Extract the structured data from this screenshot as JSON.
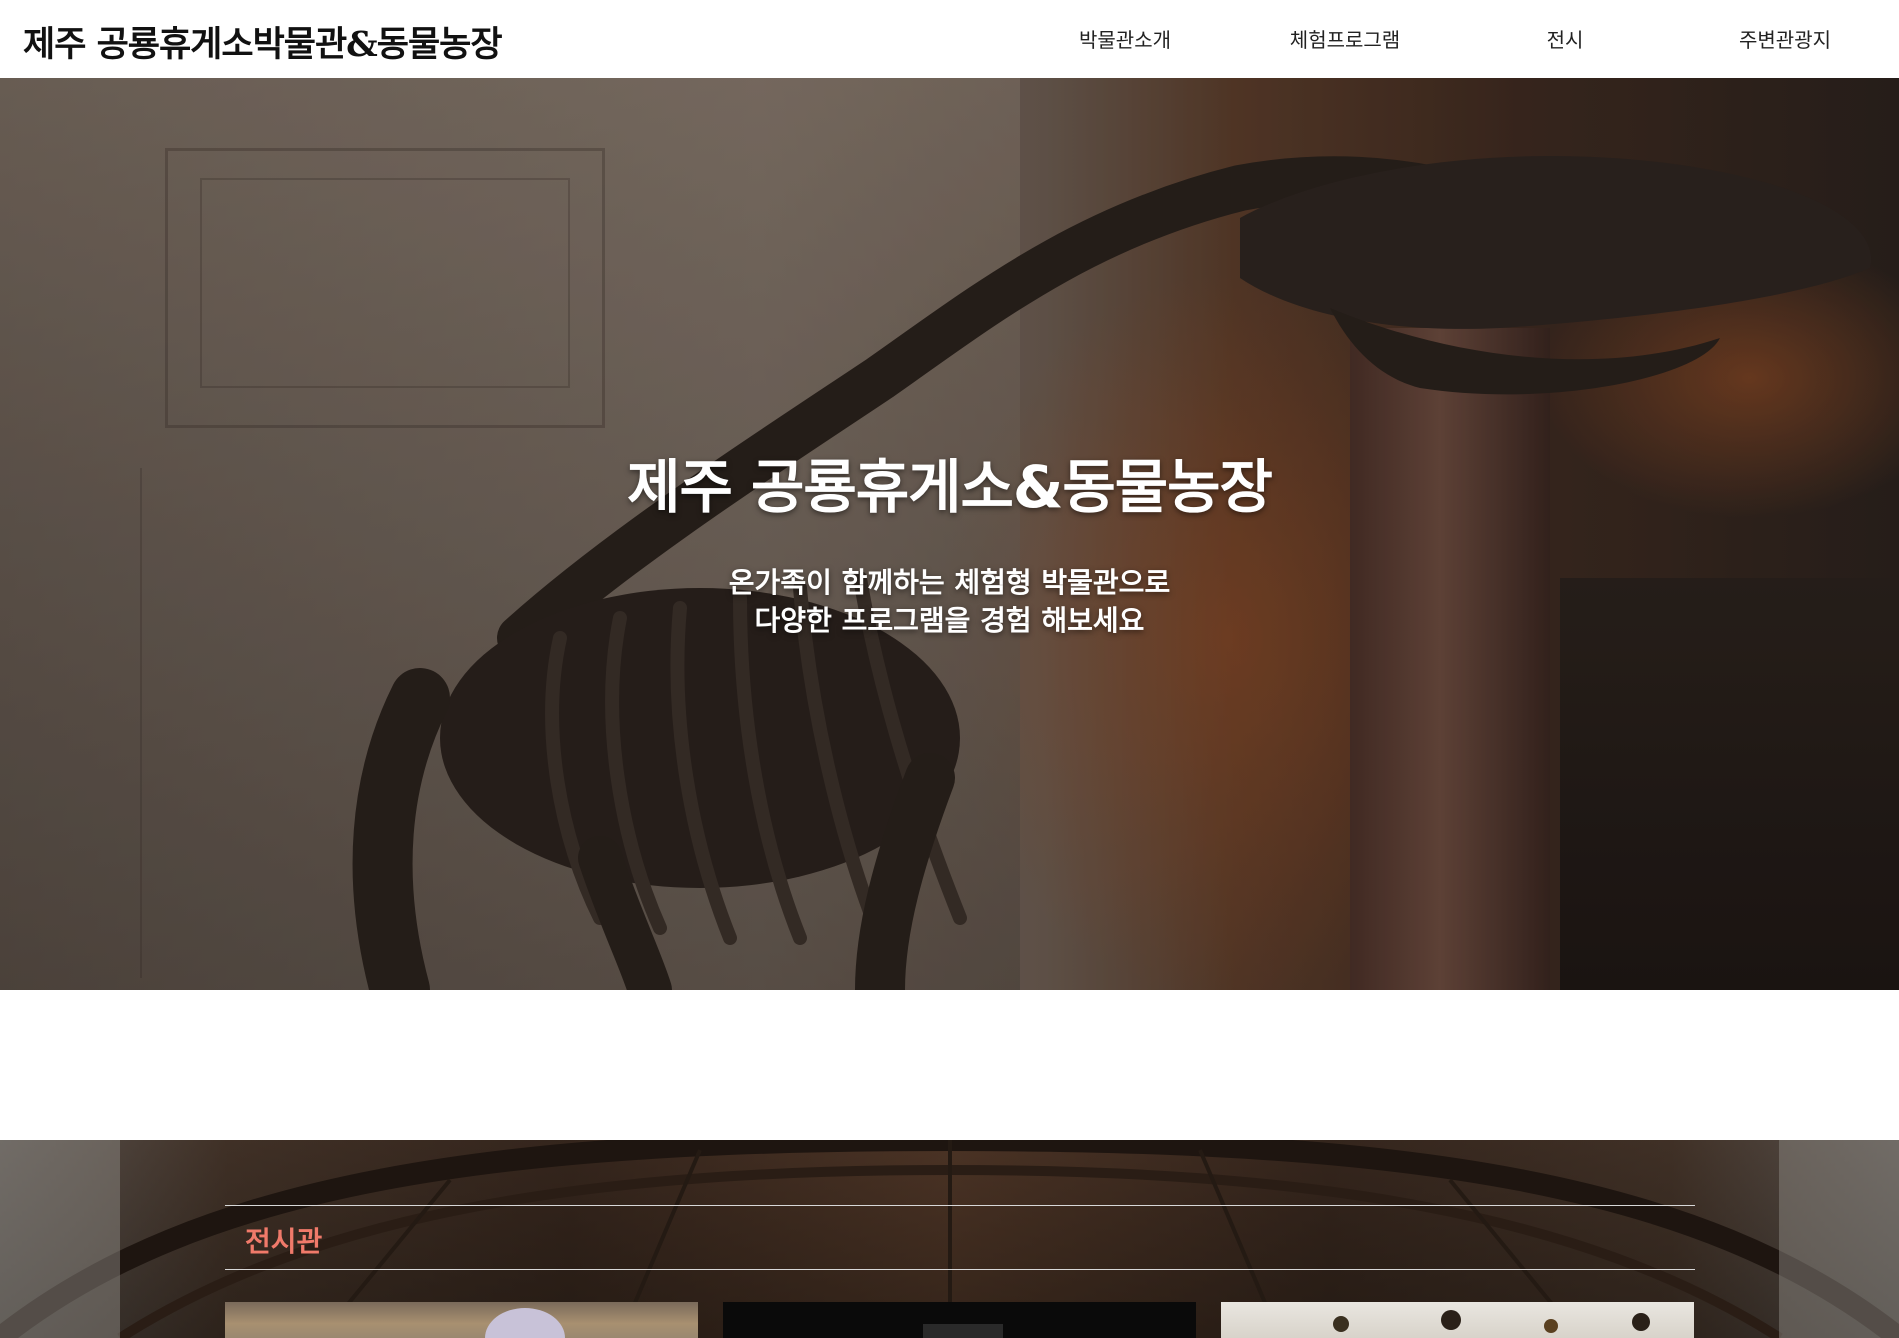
{
  "header": {
    "logo": "제주 공룡휴게소박물관&동물농장",
    "nav": [
      {
        "label": "박물관소개"
      },
      {
        "label": "체험프로그램"
      },
      {
        "label": "전시"
      },
      {
        "label": "주변관광지"
      }
    ]
  },
  "hero": {
    "title": "제주 공룡휴게소&동물농장",
    "subtitle_line1": "온가족이 함께하는 체험형 박물관으로",
    "subtitle_line2": "다양한 프로그램을 경험 해보세요"
  },
  "exhibit": {
    "title": "전시관",
    "title_color": "#f07a6a"
  }
}
